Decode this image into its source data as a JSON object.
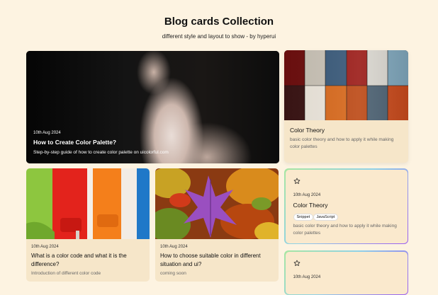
{
  "header": {
    "title": "Blog cards Collection",
    "subtitle": "different style and layout to show - by hyperui"
  },
  "hero": {
    "date": "10th Aug 2024",
    "title": "How to Create Color Palette?",
    "description": "Step-by-step guide of how to create color palette on uicolorful.com"
  },
  "color_theory_image_card": {
    "title": "Color Theory",
    "description_line1": "basic color theory and how to apply it while making",
    "description_line2": "color palettes"
  },
  "paint_card": {
    "date": "10th Aug 2024",
    "title_line1": "What is a color code and what it is the",
    "title_line2": "difference?",
    "description": "Introduction of different color code"
  },
  "leaves_card": {
    "date": "10th Aug 2024",
    "title_line1": "How to choose suitable color in different",
    "title_line2": "situation and ui?",
    "description": "coming soon"
  },
  "featured_card": {
    "date": "10th Aug 2024",
    "title": "Color Theory",
    "tags": [
      "Snippet",
      "JavaScript"
    ],
    "description_line1": "basic color theory and how to apply it while making",
    "description_line2": "color palettes"
  },
  "bottom_card": {
    "date": "10th Aug 2024"
  },
  "icons": {
    "bookmark": "star-icon"
  }
}
